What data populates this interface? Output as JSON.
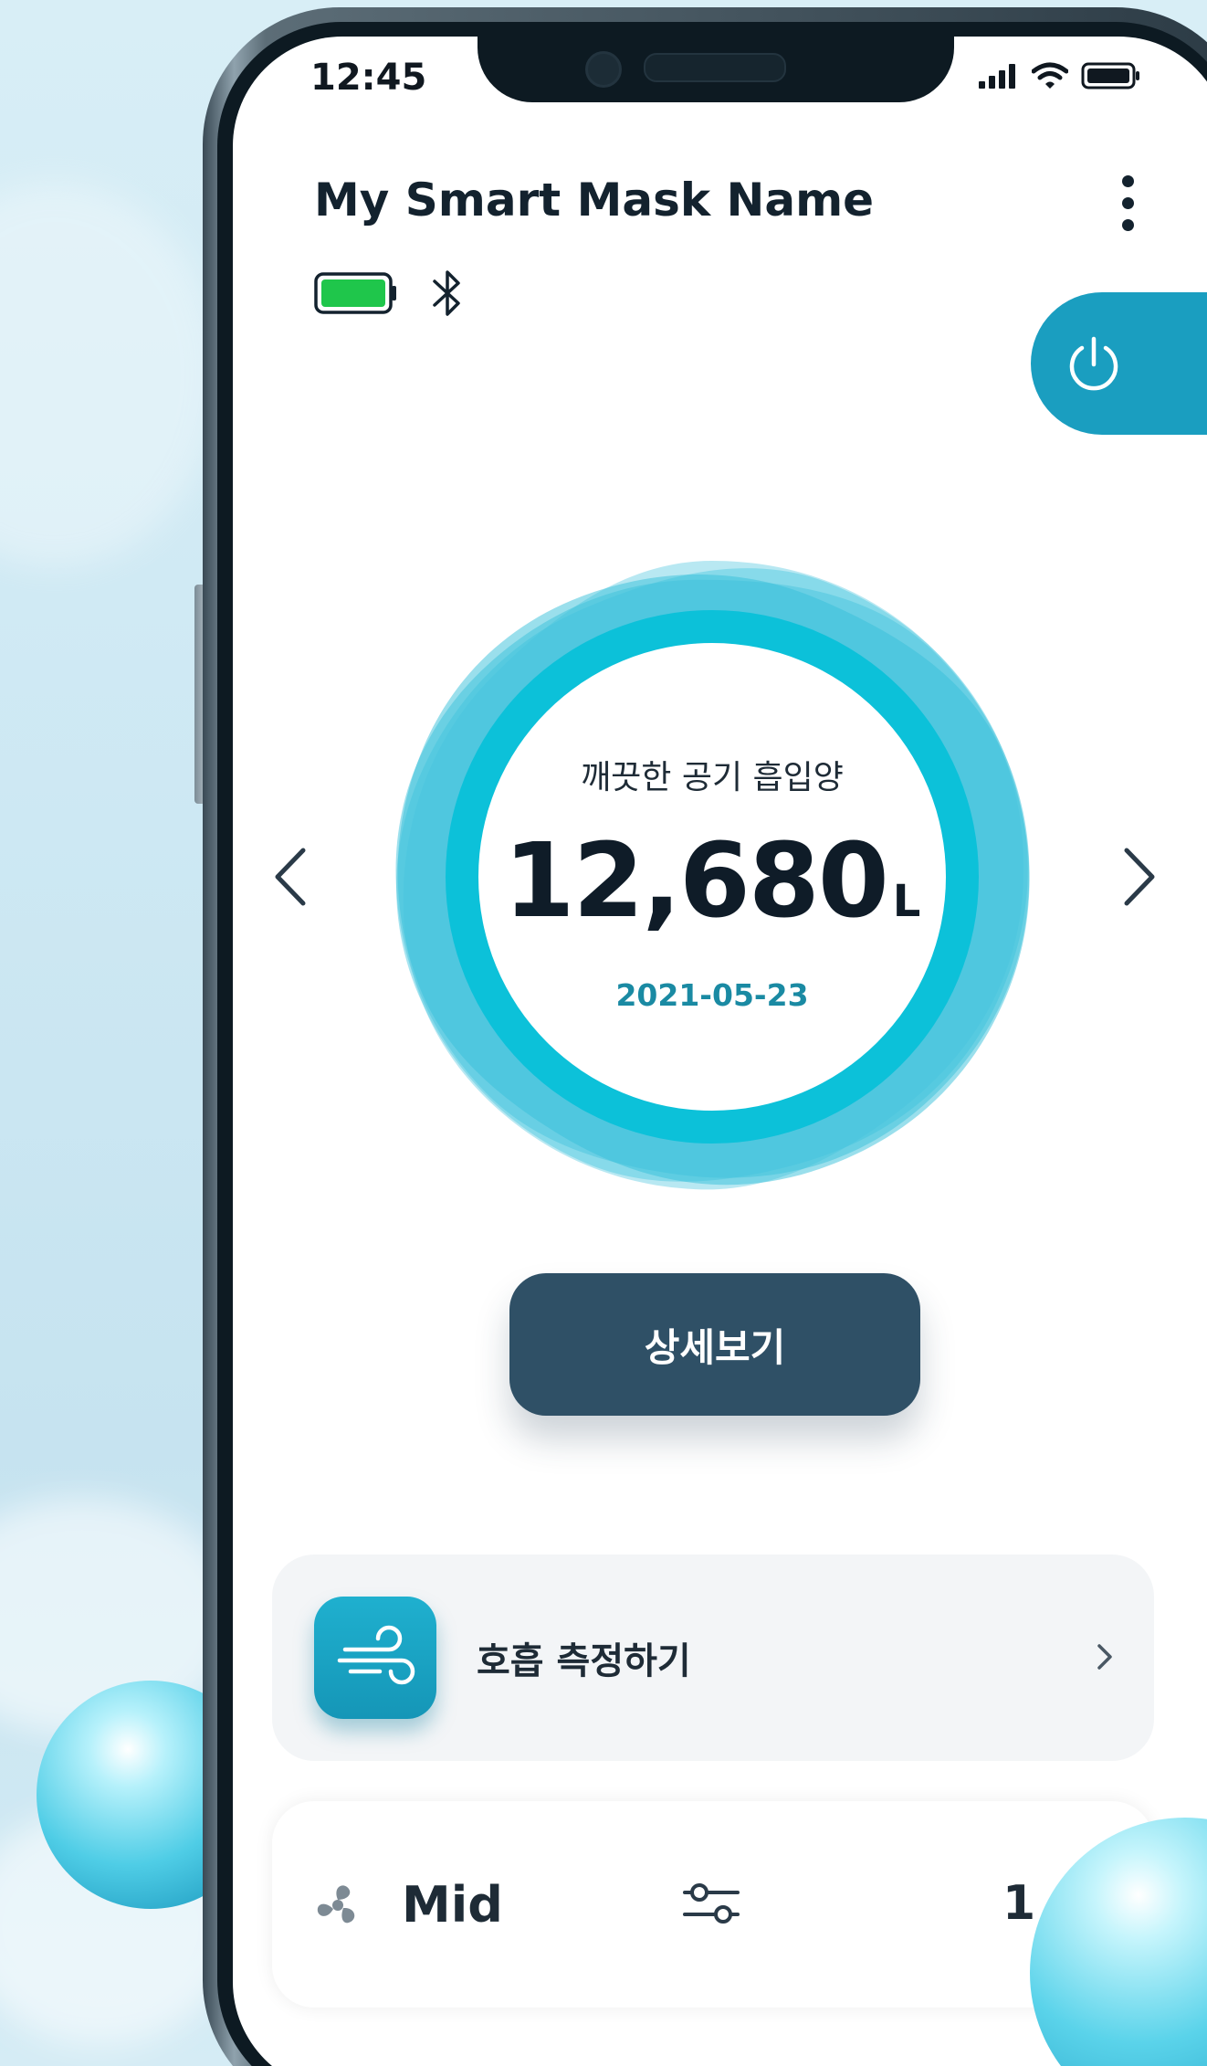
{
  "status_bar": {
    "time": "12:45"
  },
  "header": {
    "title": "My Smart Mask Name"
  },
  "colors": {
    "accent": "#00c0d8",
    "button": "#2f5066",
    "battery": "#1fc64b",
    "date": "#1a8aa3"
  },
  "gauge": {
    "label": "깨끗한 공기 흡입양",
    "value": "12,680",
    "unit": "L",
    "date": "2021-05-23"
  },
  "detail_button": {
    "label": "상세보기"
  },
  "breath_card": {
    "label": "호흡 측정하기"
  },
  "mode_card": {
    "mode": "Mid",
    "count": "1"
  },
  "icons": [
    "battery-icon",
    "bluetooth-icon",
    "more-icon",
    "power-icon",
    "chevron-left-icon",
    "chevron-right-icon",
    "wind-icon",
    "fan-icon",
    "slider-icon",
    "chevron-right-icon"
  ]
}
